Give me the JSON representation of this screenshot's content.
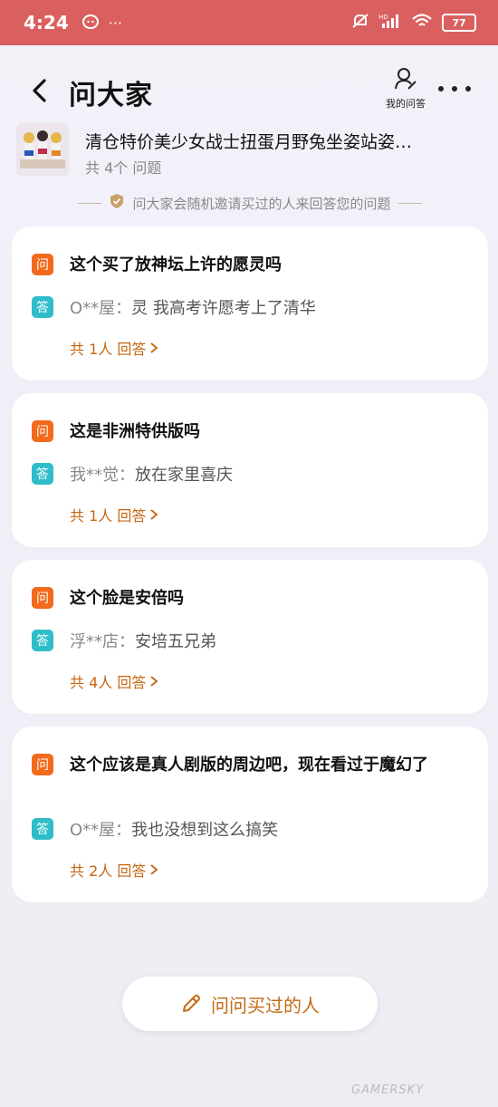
{
  "status_bar": {
    "time": "4:24",
    "left_icons": [
      "pig-icon",
      "more-dots"
    ],
    "left_dots": "···",
    "network_label": "HD",
    "battery": "77"
  },
  "header": {
    "title": "问大家",
    "my_qa_label": "我的问答"
  },
  "product": {
    "name": "清仓特价美少女战士扭蛋月野兔坐姿站姿…",
    "question_count": "共 4个 问题"
  },
  "notice": "问大家会随机邀请买过的人来回答您的问题",
  "badges": {
    "question": "问",
    "answer": "答"
  },
  "questions": [
    {
      "question": "这个买了放神坛上许的愿灵吗",
      "answer_user": "O**屋：",
      "answer": "灵 我高考许愿考上了清华",
      "count_label": "共 1人 回答"
    },
    {
      "question": "这是非洲特供版吗",
      "answer_user": "我**觉：",
      "answer": "放在家里喜庆",
      "count_label": "共 1人 回答"
    },
    {
      "question": "这个脸是安倍吗",
      "answer_user": "浮**店：",
      "answer": "安培五兄弟",
      "count_label": "共 4人 回答"
    },
    {
      "question": "这个应该是真人剧版的周边吧，现在看过于魔幻了",
      "answer_user": "O**屋：",
      "answer": "我也没想到这么搞笑",
      "count_label": "共 2人 回答"
    }
  ],
  "ask_button_label": "问问买过的人",
  "watermark": "GAMERSKY",
  "colors": {
    "status_bar": "#d9605f",
    "question_badge": "#f26a1c",
    "answer_badge": "#2ebdc9",
    "accent": "#c8650f"
  }
}
